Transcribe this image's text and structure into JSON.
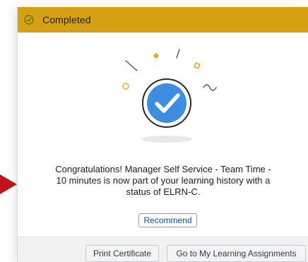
{
  "status": {
    "label": "Completed",
    "icon": "check-circle-icon",
    "color": "#d6a015"
  },
  "illustration": {
    "icon": "large-check-icon",
    "color": "#3d8de3"
  },
  "message": "Congratulations! Manager Self Service - Team Time - 10 minutes is now part of your learning history with a status of ELRN-C.",
  "actions": {
    "recommend_label": "Recommend",
    "print_label": "Print Certificate",
    "go_label": "Go to My Learning Assignments"
  }
}
